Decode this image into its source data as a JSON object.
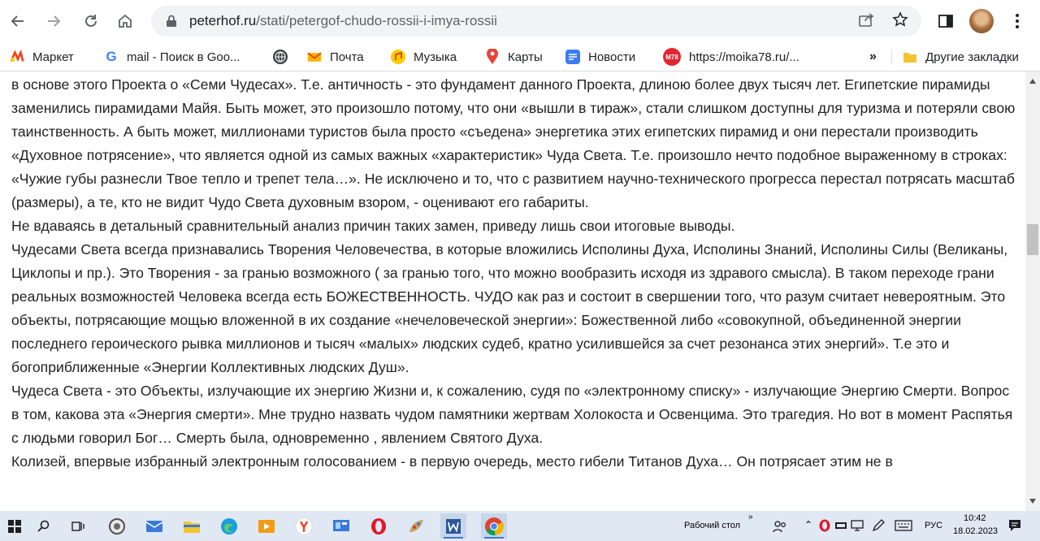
{
  "browser": {
    "url_domain": "peterhof.ru",
    "url_path": "/stati/petergof-chudo-rossii-i-imya-rossii"
  },
  "bookmarks": [
    {
      "label": "Маркет",
      "icon": "yandex-market-icon",
      "color": "#fc3f1d"
    },
    {
      "label": "mail - Поиск в Goo...",
      "icon": "google-icon",
      "color": "#4285f4"
    },
    {
      "label": "",
      "icon": "globe-icon",
      "color": "#202124"
    },
    {
      "label": "Почта",
      "icon": "mail-icon",
      "color": "#f8b400"
    },
    {
      "label": "Музыка",
      "icon": "music-icon",
      "color": "#ffcc00"
    },
    {
      "label": "Карты",
      "icon": "maps-pin-icon",
      "color": "#ea4335"
    },
    {
      "label": "Новости",
      "icon": "news-icon",
      "color": "#3c7bf4"
    },
    {
      "label": "https://moika78.ru/...",
      "icon": "m78-icon",
      "color": "#e3262f",
      "badge": "M78"
    }
  ],
  "bookmarks_more": "»",
  "other_bookmarks": "Другие закладки",
  "article": {
    "paragraphs": [
      "в основе этого Проекта о «Семи Чудесах». Т.е. античность - это фундамент данного Проекта, длиною более двух тысяч лет. Египетские пирамиды заменились пирамидами Майя. Быть может, это произошло потому, что они «вышли в тираж», стали слишком доступны для туризма и потеряли свою таинственность. А быть может, миллионами туристов была просто «съедена» энергетика этих египетских пирамид и они перестали производить «Духовное потрясение», что является одной из самых важных «характеристик» Чуда Света. Т.е. произошло нечто подобное выраженному в строках: «Чужие губы разнесли Твое тепло и трепет тела…». Не исключено и то, что с развитием научно-технического прогресса перестал потрясать масштаб (размеры), а те, кто не видит Чудо Света духовным взором, - оценивают его габариты.",
      "Не вдаваясь в детальный сравнительный анализ причин таких замен, приведу лишь свои итоговые выводы.",
      "Чудесами Света всегда признавались Творения Человечества, в которые вложились Исполины Духа, Исполины Знаний, Исполины Силы (Великаны, Циклопы и пр.). Это Творения - за гранью возможного ( за гранью того, что можно вообразить исходя из здравого смысла). В таком переходе грани реальных возможностей Человека всегда есть БОЖЕСТВЕННОСТЬ. ЧУДО как раз и состоит в свершении того, что разум считает невероятным. Это объекты, потрясающие мощью вложенной в их создание «нечеловеческой энергии»: Божественной либо «совокупной, объединенной энергии последнего героического рывка миллионов и тысяч «малых» людских судеб, кратно усилившейся за счет резонанса этих энергий». Т.е это и богоприближенные «Энергии Коллективных людских Душ».",
      "Чудеса Света - это Объекты, излучающие их энергию Жизни и, к сожалению, судя по «электронному списку» - излучающие Энергию Смерти. Вопрос в том, какова эта «Энергия смерти». Мне трудно назвать чудом памятники жертвам Холокоста и Освенцима. Это трагедия. Но вот в момент Распятья с людьми говорил Бог… Смерть была, одновременно , явлением Святого Духа.",
      "Колизей, впервые избранный электронным голосованием - в первую очередь, место гибели Титанов Духа… Он потрясает этим не в"
    ]
  },
  "taskbar": {
    "desktop_label": "Рабочий стол",
    "language": "РУС",
    "time": "10:42",
    "date": "18.02.2023",
    "chevron": "»"
  }
}
